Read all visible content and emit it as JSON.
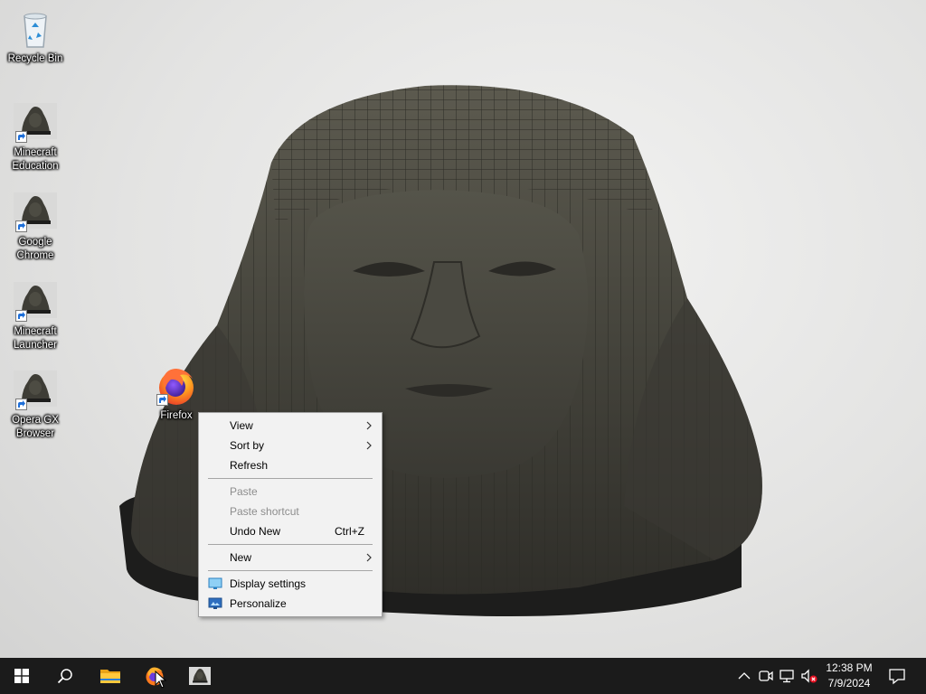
{
  "desktop": {
    "icons": [
      {
        "label": "Recycle Bin",
        "icon": "recycle-bin-icon"
      },
      {
        "label": "Minecraft Education",
        "icon": "statue-thumbnail-icon"
      },
      {
        "label": "Google Chrome",
        "icon": "statue-thumbnail-icon"
      },
      {
        "label": "Minecraft Launcher",
        "icon": "statue-thumbnail-icon"
      },
      {
        "label": "Opera GX Browser",
        "icon": "statue-thumbnail-icon"
      },
      {
        "label": "Firefox",
        "icon": "firefox-icon"
      }
    ]
  },
  "context_menu": {
    "items": {
      "view": {
        "label": "View",
        "submenu": true,
        "enabled": true
      },
      "sort_by": {
        "label": "Sort by",
        "submenu": true,
        "enabled": true
      },
      "refresh": {
        "label": "Refresh",
        "enabled": true
      },
      "paste": {
        "label": "Paste",
        "enabled": false
      },
      "paste_shortcut": {
        "label": "Paste shortcut",
        "enabled": false
      },
      "undo_new": {
        "label": "Undo New",
        "shortcut": "Ctrl+Z",
        "enabled": true
      },
      "new": {
        "label": "New",
        "submenu": true,
        "enabled": true
      },
      "display_settings": {
        "label": "Display settings",
        "icon": "display-settings-icon",
        "enabled": true
      },
      "personalize": {
        "label": "Personalize",
        "icon": "personalize-icon",
        "enabled": true
      }
    }
  },
  "taskbar": {
    "pinned": [
      {
        "name": "start",
        "icon": "windows-logo-icon"
      },
      {
        "name": "search",
        "icon": "search-icon"
      },
      {
        "name": "file-explorer",
        "icon": "folder-icon"
      },
      {
        "name": "firefox",
        "icon": "firefox-icon"
      },
      {
        "name": "statue-app",
        "icon": "statue-thumbnail-icon"
      }
    ],
    "tray": {
      "icons": [
        "chevron-up-icon",
        "meet-now-icon",
        "network-icon",
        "volume-muted-icon"
      ],
      "time": "12:38 PM",
      "date": "7/9/2024",
      "notification_icon": "notification-icon"
    }
  },
  "colors": {
    "taskbar_bg": "#1b1b1b",
    "menu_bg": "#f2f2f2",
    "menu_disabled_text": "#8d8d8d",
    "accent": "#76b9ed"
  }
}
